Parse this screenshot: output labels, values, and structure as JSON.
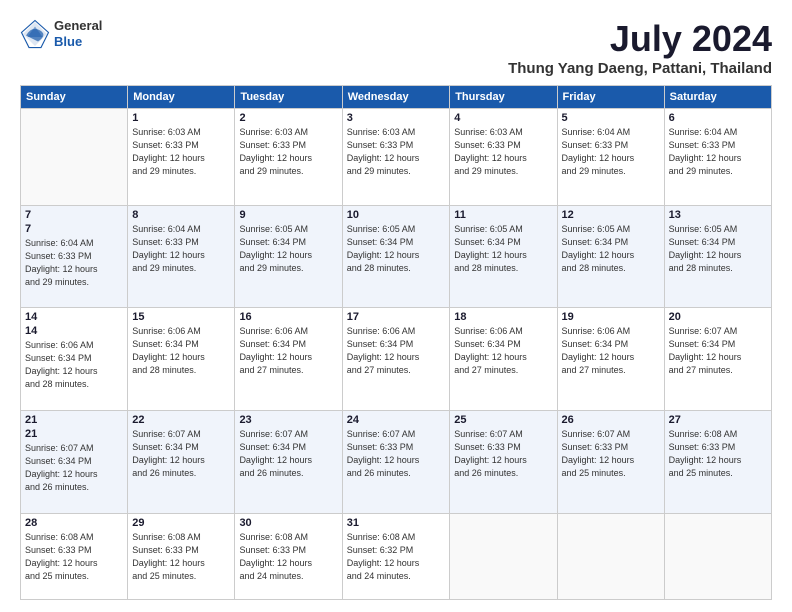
{
  "header": {
    "logo_general": "General",
    "logo_blue": "Blue",
    "month_year": "July 2024",
    "location": "Thung Yang Daeng, Pattani, Thailand"
  },
  "days_of_week": [
    "Sunday",
    "Monday",
    "Tuesday",
    "Wednesday",
    "Thursday",
    "Friday",
    "Saturday"
  ],
  "weeks": [
    [
      {
        "day": "",
        "info": ""
      },
      {
        "day": "1",
        "info": "Sunrise: 6:03 AM\nSunset: 6:33 PM\nDaylight: 12 hours\nand 29 minutes."
      },
      {
        "day": "2",
        "info": "Sunrise: 6:03 AM\nSunset: 6:33 PM\nDaylight: 12 hours\nand 29 minutes."
      },
      {
        "day": "3",
        "info": "Sunrise: 6:03 AM\nSunset: 6:33 PM\nDaylight: 12 hours\nand 29 minutes."
      },
      {
        "day": "4",
        "info": "Sunrise: 6:03 AM\nSunset: 6:33 PM\nDaylight: 12 hours\nand 29 minutes."
      },
      {
        "day": "5",
        "info": "Sunrise: 6:04 AM\nSunset: 6:33 PM\nDaylight: 12 hours\nand 29 minutes."
      },
      {
        "day": "6",
        "info": "Sunrise: 6:04 AM\nSunset: 6:33 PM\nDaylight: 12 hours\nand 29 minutes."
      }
    ],
    [
      {
        "day": "7",
        "info": ""
      },
      {
        "day": "8",
        "info": "Sunrise: 6:04 AM\nSunset: 6:33 PM\nDaylight: 12 hours\nand 29 minutes."
      },
      {
        "day": "9",
        "info": "Sunrise: 6:05 AM\nSunset: 6:34 PM\nDaylight: 12 hours\nand 29 minutes."
      },
      {
        "day": "10",
        "info": "Sunrise: 6:05 AM\nSunset: 6:34 PM\nDaylight: 12 hours\nand 28 minutes."
      },
      {
        "day": "11",
        "info": "Sunrise: 6:05 AM\nSunset: 6:34 PM\nDaylight: 12 hours\nand 28 minutes."
      },
      {
        "day": "12",
        "info": "Sunrise: 6:05 AM\nSunset: 6:34 PM\nDaylight: 12 hours\nand 28 minutes."
      },
      {
        "day": "13",
        "info": "Sunrise: 6:05 AM\nSunset: 6:34 PM\nDaylight: 12 hours\nand 28 minutes."
      }
    ],
    [
      {
        "day": "14",
        "info": ""
      },
      {
        "day": "15",
        "info": "Sunrise: 6:06 AM\nSunset: 6:34 PM\nDaylight: 12 hours\nand 28 minutes."
      },
      {
        "day": "16",
        "info": "Sunrise: 6:06 AM\nSunset: 6:34 PM\nDaylight: 12 hours\nand 27 minutes."
      },
      {
        "day": "17",
        "info": "Sunrise: 6:06 AM\nSunset: 6:34 PM\nDaylight: 12 hours\nand 27 minutes."
      },
      {
        "day": "18",
        "info": "Sunrise: 6:06 AM\nSunset: 6:34 PM\nDaylight: 12 hours\nand 27 minutes."
      },
      {
        "day": "19",
        "info": "Sunrise: 6:06 AM\nSunset: 6:34 PM\nDaylight: 12 hours\nand 27 minutes."
      },
      {
        "day": "20",
        "info": "Sunrise: 6:07 AM\nSunset: 6:34 PM\nDaylight: 12 hours\nand 27 minutes."
      }
    ],
    [
      {
        "day": "21",
        "info": ""
      },
      {
        "day": "22",
        "info": "Sunrise: 6:07 AM\nSunset: 6:34 PM\nDaylight: 12 hours\nand 26 minutes."
      },
      {
        "day": "23",
        "info": "Sunrise: 6:07 AM\nSunset: 6:34 PM\nDaylight: 12 hours\nand 26 minutes."
      },
      {
        "day": "24",
        "info": "Sunrise: 6:07 AM\nSunset: 6:33 PM\nDaylight: 12 hours\nand 26 minutes."
      },
      {
        "day": "25",
        "info": "Sunrise: 6:07 AM\nSunset: 6:33 PM\nDaylight: 12 hours\nand 26 minutes."
      },
      {
        "day": "26",
        "info": "Sunrise: 6:07 AM\nSunset: 6:33 PM\nDaylight: 12 hours\nand 25 minutes."
      },
      {
        "day": "27",
        "info": "Sunrise: 6:08 AM\nSunset: 6:33 PM\nDaylight: 12 hours\nand 25 minutes."
      }
    ],
    [
      {
        "day": "28",
        "info": "Sunrise: 6:08 AM\nSunset: 6:33 PM\nDaylight: 12 hours\nand 25 minutes."
      },
      {
        "day": "29",
        "info": "Sunrise: 6:08 AM\nSunset: 6:33 PM\nDaylight: 12 hours\nand 25 minutes."
      },
      {
        "day": "30",
        "info": "Sunrise: 6:08 AM\nSunset: 6:33 PM\nDaylight: 12 hours\nand 24 minutes."
      },
      {
        "day": "31",
        "info": "Sunrise: 6:08 AM\nSunset: 6:32 PM\nDaylight: 12 hours\nand 24 minutes."
      },
      {
        "day": "",
        "info": ""
      },
      {
        "day": "",
        "info": ""
      },
      {
        "day": "",
        "info": ""
      }
    ]
  ]
}
